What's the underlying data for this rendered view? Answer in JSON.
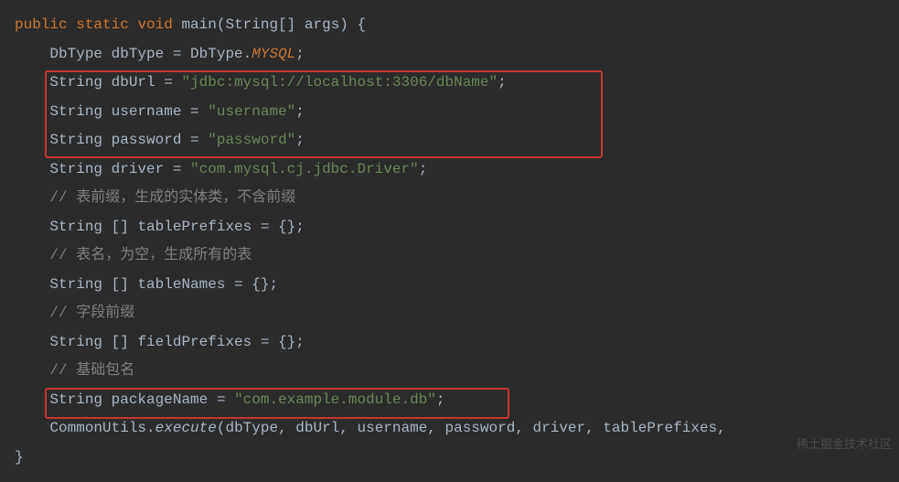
{
  "code": {
    "method_signature": {
      "public": "public",
      "static": "static",
      "void": "void",
      "name": "main",
      "params_open": "(",
      "param_type": "String[]",
      "param_name": "args",
      "params_close": ")",
      "brace": " {"
    },
    "line2": {
      "type": "DbType",
      "var": "dbType",
      "eq": " = ",
      "class": "DbType",
      "dot": ".",
      "const": "MYSQL",
      "semi": ";"
    },
    "line3": {
      "type": "String",
      "var": "dbUrl",
      "eq": " = ",
      "value": "\"jdbc:mysql://localhost:3306/dbName\"",
      "semi": ";"
    },
    "line4": {
      "type": "String",
      "var": "username",
      "eq": " = ",
      "value": "\"username\"",
      "semi": ";"
    },
    "line5": {
      "type": "String",
      "var": "password",
      "eq": " = ",
      "value": "\"password\"",
      "semi": ";"
    },
    "line6": {
      "type": "String",
      "var": "driver",
      "eq": " = ",
      "value": "\"com.mysql.cj.jdbc.Driver\"",
      "semi": ";"
    },
    "line7": {
      "comment": "// 表前缀，生成的实体类，不含前缀"
    },
    "line8": {
      "type": "String []",
      "var": "tablePrefixes",
      "eq": " = {}",
      "semi": ";"
    },
    "line9": {
      "comment": "// 表名，为空，生成所有的表"
    },
    "line10": {
      "type": "String []",
      "var": "tableNames",
      "eq": " = {}",
      "semi": ";"
    },
    "line11": {
      "comment": "// 字段前缀"
    },
    "line12": {
      "type": "String []",
      "var": "fieldPrefixes",
      "eq": " = {}",
      "semi": ";"
    },
    "line13": {
      "comment": "// 基础包名"
    },
    "line14": {
      "type": "String",
      "var": "packageName",
      "eq": " = ",
      "value": "\"com.example.module.db\"",
      "semi": ";"
    },
    "line15": {
      "class": "CommonUtils",
      "dot": ".",
      "method": "execute",
      "args": "(dbType, dbUrl, username, password, driver, tablePrefixes,"
    },
    "line16": {
      "brace": "}"
    }
  },
  "watermark": "稀土掘金技术社区"
}
